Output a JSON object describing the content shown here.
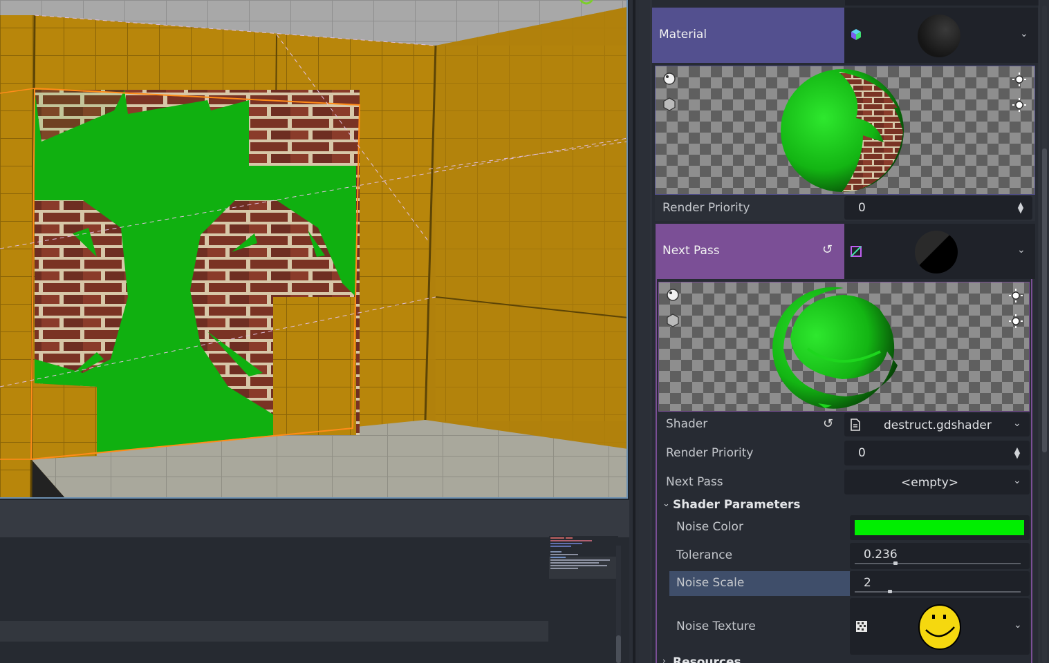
{
  "inspector": {
    "material": {
      "label": "Material",
      "render_priority_label": "Render Priority",
      "render_priority_value": "0"
    },
    "next_pass": {
      "label": "Next Pass",
      "shader_label": "Shader",
      "shader_value": "destruct.gdshader",
      "render_priority_label": "Render Priority",
      "render_priority_value": "0",
      "next_pass_label": "Next Pass",
      "next_pass_value": "<empty>"
    },
    "shader_parameters": {
      "heading": "Shader Parameters",
      "noise_color_label": "Noise Color",
      "noise_color_value": "#00ee00",
      "tolerance_label": "Tolerance",
      "tolerance_value": "0.236",
      "tolerance_fraction": 0.236,
      "noise_scale_label": "Noise Scale",
      "noise_scale_value": "2",
      "noise_texture_label": "Noise Texture"
    },
    "resources_heading": "Resources"
  },
  "colors": {
    "material_header": "#53508f",
    "next_pass_header": "#7b4f96",
    "selected_row": "#3f4e6a",
    "wall": "#b8860b",
    "green": "#10b010"
  }
}
